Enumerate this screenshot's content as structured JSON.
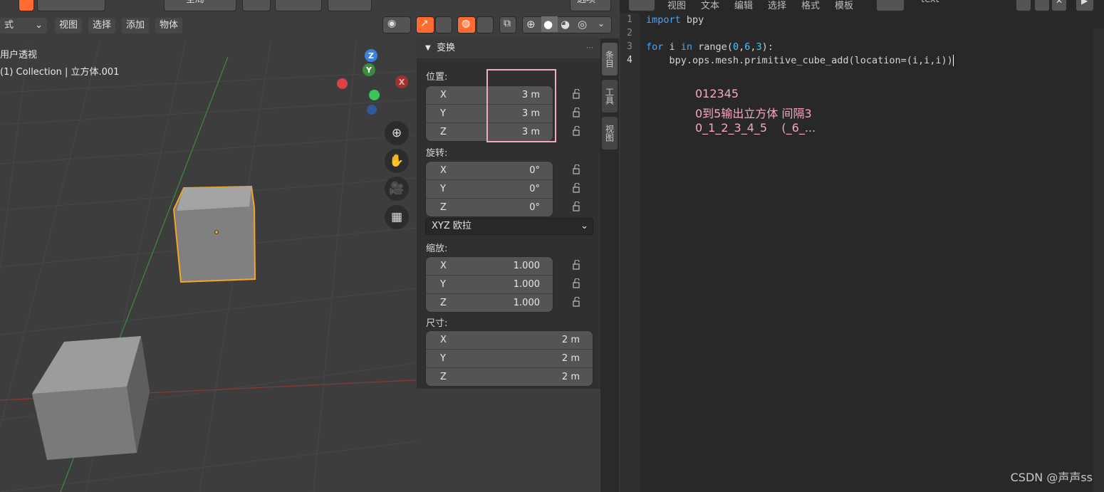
{
  "viewport": {
    "menu": [
      "式",
      "视图",
      "选择",
      "添加",
      "物体"
    ],
    "scope_label": "全局",
    "options_label": "选项",
    "perspective_label": "用户透视",
    "collection_label": "(1) Collection | 立方体.001",
    "gizmo": {
      "z": "Z",
      "y": "Y",
      "x": "X"
    }
  },
  "npanel": {
    "tabs": [
      "条目",
      "工具",
      "视图"
    ],
    "transform_header": "变换",
    "location": {
      "label": "位置:",
      "rows": [
        {
          "axis": "X",
          "value": "3 m"
        },
        {
          "axis": "Y",
          "value": "3 m"
        },
        {
          "axis": "Z",
          "value": "3 m"
        }
      ]
    },
    "rotation": {
      "label": "旋转:",
      "rows": [
        {
          "axis": "X",
          "value": "0°"
        },
        {
          "axis": "Y",
          "value": "0°"
        },
        {
          "axis": "Z",
          "value": "0°"
        }
      ]
    },
    "rotation_mode": "XYZ 欧拉",
    "scale": {
      "label": "缩放:",
      "rows": [
        {
          "axis": "X",
          "value": "1.000"
        },
        {
          "axis": "Y",
          "value": "1.000"
        },
        {
          "axis": "Z",
          "value": "1.000"
        }
      ]
    },
    "dimensions": {
      "label": "尺寸:",
      "rows": [
        {
          "axis": "X",
          "value": "2 m"
        },
        {
          "axis": "Y",
          "value": "2 m"
        },
        {
          "axis": "Z",
          "value": "2 m"
        }
      ]
    }
  },
  "editor": {
    "menu": [
      "视图",
      "文本",
      "编辑",
      "选择",
      "格式",
      "模板"
    ],
    "text_name": "text",
    "line_numbers": [
      "1",
      "2",
      "3",
      "4"
    ],
    "code": {
      "line1_kw": "import",
      "line1_rest": " bpy",
      "line3_kw1": "for",
      "line3_a": " i ",
      "line3_kw2": "in",
      "line3_b": " range(",
      "line3_n1": "0",
      "line3_c1": ",",
      "line3_n2": "6",
      "line3_c2": ",",
      "line3_n3": "3",
      "line3_end": "):",
      "line4": "    bpy.ops.mesh.primitive_cube_add(location=(i,i,i))"
    },
    "notes": [
      "012345",
      "0到5输出立方体 间隔3",
      "0_1_2_3_4_5    (_6_..."
    ]
  },
  "watermark": "CSDN @声声ss",
  "colors": {
    "selection_outline": "#f5a623",
    "highlight_box": "#f6a7c5",
    "keyword": "#46a5ff",
    "note_text": "#f6a7c5"
  }
}
